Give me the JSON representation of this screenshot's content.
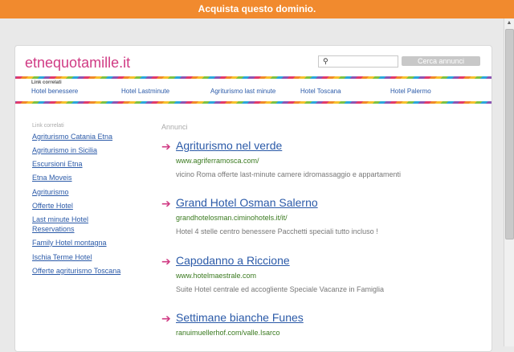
{
  "topbar": {
    "text": "Acquista questo dominio."
  },
  "header": {
    "site_title": "etnequotamille.it",
    "search_placeholder": "",
    "search_button": "Cerca annunci",
    "search_icon": "search-icon"
  },
  "related_bar": {
    "label": "Link correlati",
    "links": [
      "Hotel benessere",
      "Hotel Lastminute",
      "Agriturismo last minute",
      "Hotel Toscana",
      "Hotel Palermo"
    ]
  },
  "sidebar": {
    "heading": "Link correlati",
    "links": [
      "Agriturismo Catania Etna",
      "Agriturismo in Sicilia",
      "Escursioni Etna",
      "Etna Moveis",
      "Agriturismo",
      "Offerte Hotel",
      "Last minute Hotel Reservations",
      "Family Hotel montagna",
      "Ischia Terme Hotel",
      "Offerte agriturismo Toscana"
    ]
  },
  "ads": {
    "heading": "Annunci",
    "arrow": "➔",
    "items": [
      {
        "title": "Agriturismo nel verde",
        "url": "www.agriferramosca.com/",
        "desc": "vicino Roma offerte last-minute camere idromassaggio e appartamenti"
      },
      {
        "title": "Grand Hotel Osman Salerno",
        "url": "grandhotelosman.ciminohotels.it/it/",
        "desc": "Hotel 4 stelle centro benessere Pacchetti speciali tutto incluso !"
      },
      {
        "title": "Capodanno a Riccione",
        "url": "www.hotelmaestrale.com",
        "desc": "Suite Hotel centrale ed accogliente Speciale Vacanze in Famiglia"
      },
      {
        "title": "Settimane bianche Funes",
        "url": "ranuimuellerhof.com/valle.Isarco",
        "desc": ""
      }
    ]
  }
}
